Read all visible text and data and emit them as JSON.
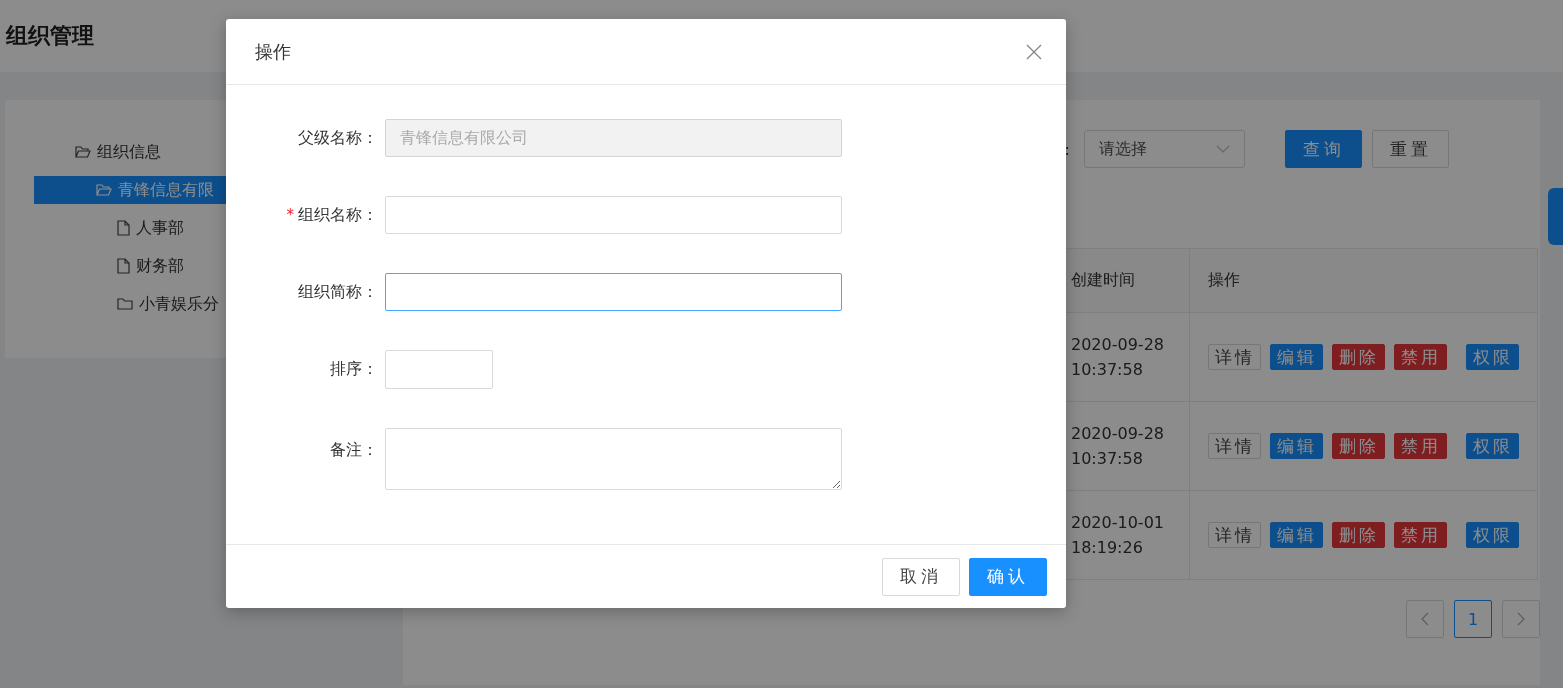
{
  "page": {
    "title": "组织管理"
  },
  "tree": {
    "items": [
      {
        "label": "组织信息",
        "kind": "folder-open",
        "selected": false,
        "children": [
          {
            "label": "青锋信息有限",
            "kind": "folder-open",
            "selected": true,
            "children": [
              {
                "label": "人事部",
                "kind": "file",
                "selected": false
              },
              {
                "label": "财务部",
                "kind": "file",
                "selected": false
              },
              {
                "label": "小青娱乐分",
                "kind": "folder",
                "selected": false
              }
            ]
          }
        ]
      }
    ]
  },
  "filter": {
    "label_fragment": ":",
    "select": {
      "placeholder": "请选择"
    },
    "buttons": [
      {
        "label": "查询",
        "kind": "primary"
      },
      {
        "label": "重置",
        "kind": "default"
      }
    ]
  },
  "table": {
    "columns": [
      "创建时间",
      "操作"
    ],
    "rows": [
      {
        "created": "2020-09-28 10:37:58",
        "actions": [
          {
            "label": "详情",
            "kind": "default"
          },
          {
            "label": "编辑",
            "kind": "primary"
          },
          {
            "label": "删除",
            "kind": "danger"
          },
          {
            "label": "禁用",
            "kind": "danger"
          },
          {
            "label": "权限",
            "kind": "primary"
          }
        ]
      },
      {
        "created": "2020-09-28 10:37:58",
        "actions": [
          {
            "label": "详情",
            "kind": "default"
          },
          {
            "label": "编辑",
            "kind": "primary"
          },
          {
            "label": "删除",
            "kind": "danger"
          },
          {
            "label": "禁用",
            "kind": "danger"
          },
          {
            "label": "权限",
            "kind": "primary"
          }
        ]
      },
      {
        "created": "2020-10-01 18:19:26",
        "actions": [
          {
            "label": "详情",
            "kind": "default"
          },
          {
            "label": "编辑",
            "kind": "primary"
          },
          {
            "label": "删除",
            "kind": "danger"
          },
          {
            "label": "禁用",
            "kind": "danger"
          },
          {
            "label": "权限",
            "kind": "primary"
          }
        ]
      }
    ]
  },
  "pagination": {
    "pages": [
      {
        "label": "1",
        "selected": true
      }
    ]
  },
  "modal": {
    "title": "操作",
    "fields": [
      {
        "label": "父级名称：",
        "kind": "input",
        "value": "青锋信息有限公司",
        "disabled": true,
        "focused": false
      },
      {
        "label": "组织名称：",
        "kind": "input",
        "marker": "*",
        "disabled": false,
        "focused": false
      },
      {
        "label": "组织简称：",
        "kind": "input",
        "disabled": false,
        "focused": true
      },
      {
        "label": "排序：",
        "kind": "short",
        "disabled": false,
        "focused": false
      },
      {
        "label": "备注：",
        "kind": "textarea",
        "disabled": false,
        "focused": false
      }
    ],
    "buttons": [
      {
        "label": "取消",
        "kind": "default"
      },
      {
        "label": "确认",
        "kind": "primary"
      }
    ]
  }
}
